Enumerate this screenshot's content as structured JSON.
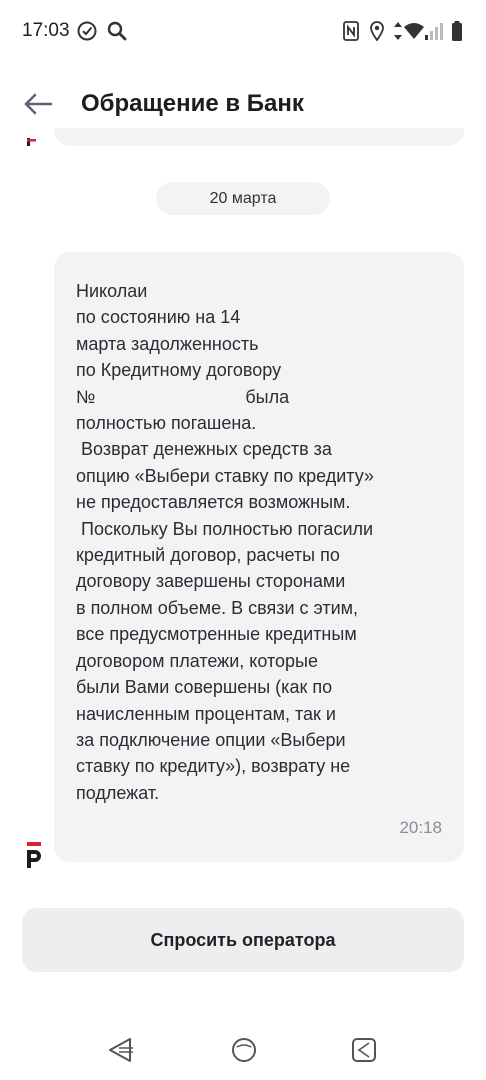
{
  "status_bar": {
    "time": "17:03",
    "icons": [
      "check-circle-icon",
      "search-icon",
      "nfc-icon",
      "location-icon",
      "data-arrows-icon",
      "wifi-icon",
      "signal-icon",
      "battery-icon"
    ]
  },
  "header": {
    "title": "Обращение в Банк",
    "back_icon": "arrow-left-icon"
  },
  "chat": {
    "date": "20 марта",
    "message": {
      "text": "Николаи\nпо состоянию на 14\nмарта задолженность\nпо Кредитному договору\n№                              была\nполностью погашена.\n Возврат денежных средств за\nопцию «Выбери ставку по кредиту»\nне предоставляется возможным.\n Поскольку Вы полностью погасили\nкредитный договор, расчеты по\nдоговору завершены сторонами\nв полном объеме. В связи с этим,\nвсе предусмотренные кредитным\nдоговором платежи, которые\nбыли Вами совершены (как по\nначисленным процентам, так и\nза подключение опции «Выбери\nставку по кредиту»), возврату не\nподлежат.",
      "time": "20:18",
      "sender_icon": "bank-logo-icon"
    }
  },
  "actions": {
    "operator_button": "Спросить оператора"
  },
  "nav_bar": {
    "icons": [
      "nav-back-icon",
      "nav-home-icon",
      "nav-recents-icon"
    ]
  },
  "colors": {
    "bubble": "#f2f3f5",
    "button": "#eceef0",
    "text": "#2b2d30",
    "time": "#8a8d91",
    "logo": "#d7262f"
  }
}
